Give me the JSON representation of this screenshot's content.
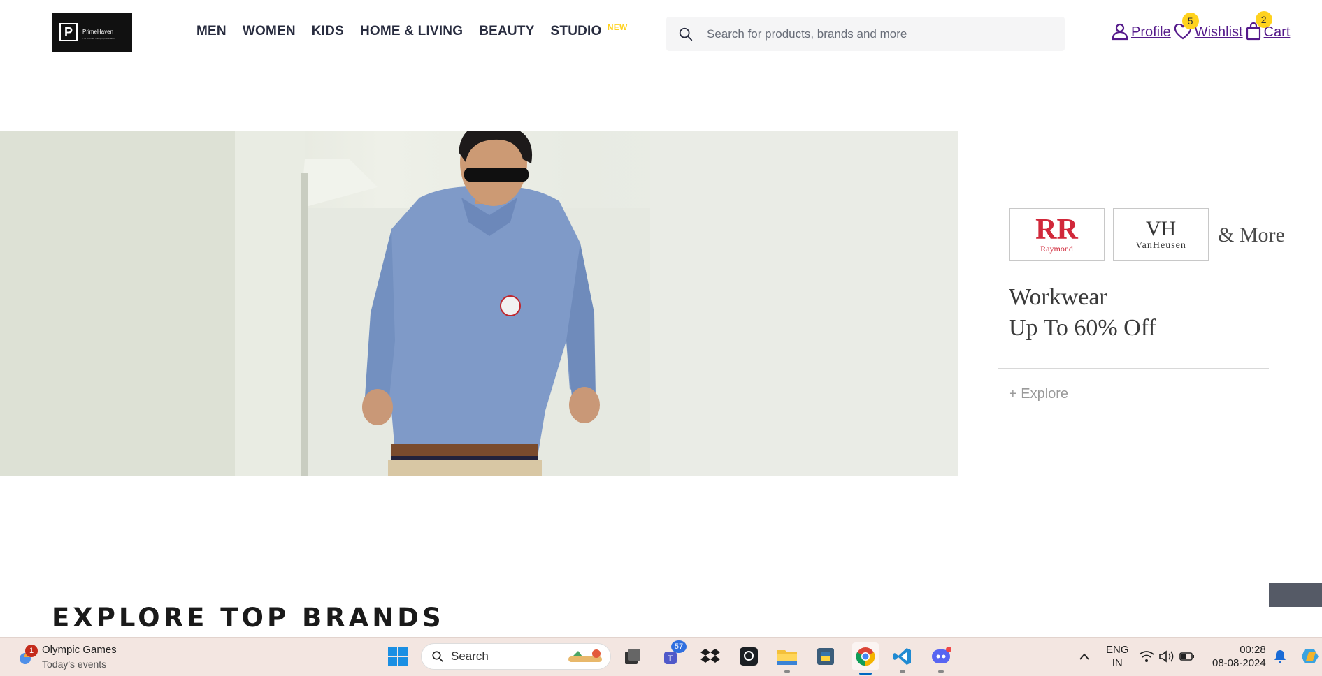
{
  "header": {
    "logo": {
      "letter": "P",
      "name": "PrimeHaven",
      "tagline": "The Ultimate Shopping Destination"
    },
    "nav": [
      {
        "label": "MEN"
      },
      {
        "label": "WOMEN"
      },
      {
        "label": "KIDS"
      },
      {
        "label": "HOME & LIVING"
      },
      {
        "label": "BEAUTY"
      },
      {
        "label": "STUDIO",
        "badge": "NEW"
      }
    ],
    "search": {
      "placeholder": "Search for products, brands and more",
      "value": ""
    },
    "actions": {
      "profile": {
        "label": "Profile"
      },
      "wishlist": {
        "label": "Wishlist",
        "count": "5"
      },
      "cart": {
        "label": "Cart",
        "count": "2"
      }
    },
    "accent_color": "#ffd21e",
    "link_color": "#551a8b"
  },
  "banner": {
    "brands": [
      {
        "name": "Raymond",
        "mark": "RR",
        "color": "#d1283a"
      },
      {
        "name": "VanHeusen",
        "mark": "VH",
        "color": "#333333"
      }
    ],
    "and_more": "& More",
    "headline_line1": "Workwear",
    "headline_line2": "Up To 60% Off",
    "cta": "+ Explore"
  },
  "section": {
    "title": "EXPLORE TOP BRANDS"
  },
  "taskbar": {
    "weather": {
      "title": "Olympic Games",
      "subtitle": "Today's events",
      "badge": "1"
    },
    "search_label": "Search",
    "teams_badge": "57",
    "language": "ENG",
    "region": "IN",
    "time": "00:28",
    "date": "08-08-2024"
  }
}
